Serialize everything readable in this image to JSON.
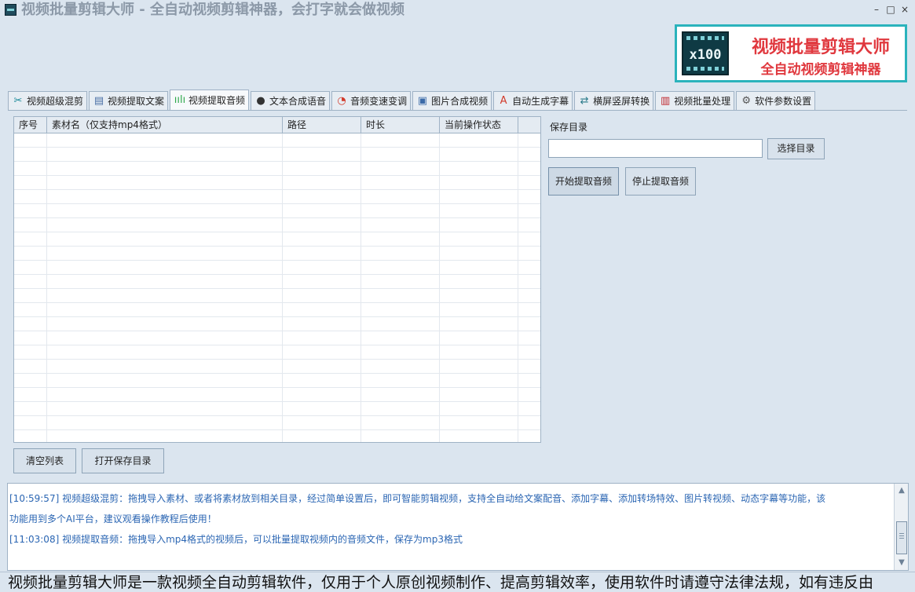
{
  "window": {
    "title": "视频批量剪辑大师 - 全自动视频剪辑神器，会打字就会做视频",
    "minimize": "–",
    "maximize": "□",
    "close": "×"
  },
  "banner": {
    "logo_text": "x100",
    "title": "视频批量剪辑大师",
    "subtitle": "全自动视频剪辑神器"
  },
  "tabs": [
    {
      "label": "视频超级混剪",
      "icon": "scissors-icon",
      "glyph": "✂",
      "color": "#1a8a9a"
    },
    {
      "label": "视频提取文案",
      "icon": "document-icon",
      "glyph": "▤",
      "color": "#4a6fa5"
    },
    {
      "label": "视频提取音频",
      "icon": "waveform-icon",
      "glyph": "ıılı",
      "color": "#2da84a",
      "active": true
    },
    {
      "label": "文本合成语音",
      "icon": "microphone-icon",
      "glyph": "●",
      "color": "#333333"
    },
    {
      "label": "音频变速变调",
      "icon": "speedometer-icon",
      "glyph": "◔",
      "color": "#d23a2a"
    },
    {
      "label": "图片合成视频",
      "icon": "picture-icon",
      "glyph": "▣",
      "color": "#3b6aa8"
    },
    {
      "label": "自动生成字幕",
      "icon": "font-icon",
      "glyph": "A",
      "color": "#d23a2a"
    },
    {
      "label": "横屏竖屏转换",
      "icon": "rotate-screen-icon",
      "glyph": "⇄",
      "color": "#2a7a8a"
    },
    {
      "label": "视频批量处理",
      "icon": "film-icon",
      "glyph": "▥",
      "color": "#c0282e"
    },
    {
      "label": "软件参数设置",
      "icon": "gear-icon",
      "glyph": "⚙",
      "color": "#555555"
    }
  ],
  "table": {
    "columns": [
      {
        "label": "序号"
      },
      {
        "label": "素材名（仅支持mp4格式）"
      },
      {
        "label": "路径"
      },
      {
        "label": "时长"
      },
      {
        "label": "当前操作状态"
      }
    ],
    "rows": []
  },
  "right_panel": {
    "save_dir_label": "保存目录",
    "save_dir_value": "",
    "choose_dir_button": "选择目录",
    "start_button": "开始提取音频",
    "stop_button": "停止提取音频"
  },
  "bottom_buttons": {
    "clear_list": "清空列表",
    "open_save_dir": "打开保存目录"
  },
  "log": {
    "line1": "[10:59:57] 视频超级混剪：拖拽导入素材、或者将素材放到相关目录，经过简单设置后，即可智能剪辑视频，支持全自动给文案配音、添加字幕、添加转场特效、图片转视频、动态字幕等功能，该",
    "line2": "功能用到多个AI平台，建议观看操作教程后使用！",
    "line3": "[11:03:08] 视频提取音频：拖拽导入mp4格式的视频后，可以批量提取视频内的音频文件，保存为mp3格式"
  },
  "marquee": {
    "text": "视频批量剪辑大师是一款视频全自动剪辑软件，仅用于个人原创视频制作、提高剪辑效率，使用软件时请遵守法律法规，如有违反由"
  }
}
